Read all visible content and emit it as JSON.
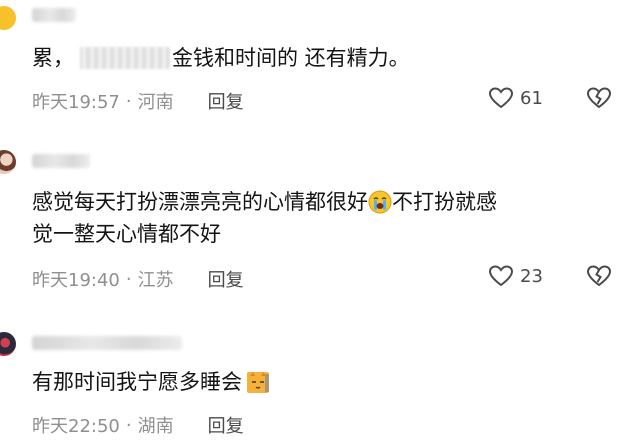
{
  "comments": [
    {
      "text_before": "累，",
      "text_after": "金钱和时间的 还有精力。",
      "time": "昨天19:57",
      "location": "河南",
      "reply_label": "回复",
      "like_count": "61"
    },
    {
      "text_before": "感觉每天打扮漂漂亮亮的心情都很好",
      "text_after": "不打扮就感",
      "text_line2": "觉一整天心情都不好",
      "time": "昨天19:40",
      "location": "江苏",
      "reply_label": "回复",
      "like_count": "23",
      "emoji_icon": "crying-face-icon"
    },
    {
      "text_before": "有那时间我宁愿多睡会",
      "time": "昨天22:50",
      "location": "湖南",
      "reply_label": "回复",
      "emoji_icon": "sleepy-cat-icon"
    }
  ],
  "icons": {
    "like": "heart-icon",
    "dislike": "broken-heart-icon"
  },
  "colors": {
    "meta_text": "#8f8f8f",
    "body_text": "#141414",
    "avatar_1": "#f6c12a"
  }
}
